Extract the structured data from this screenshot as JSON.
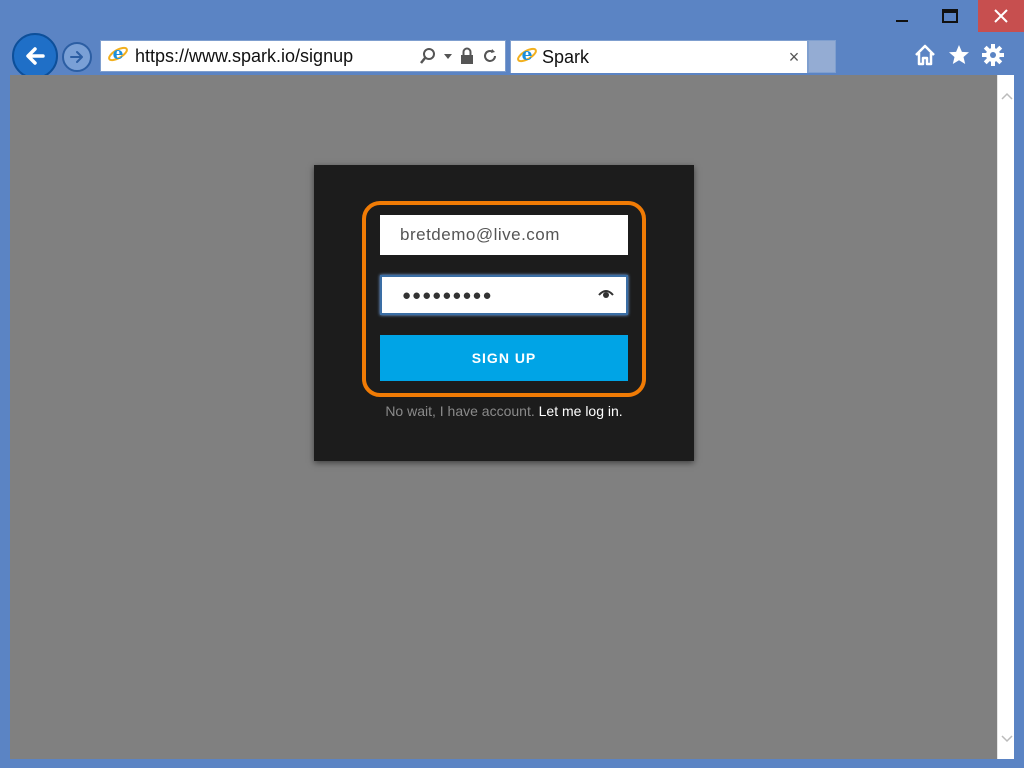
{
  "browser": {
    "url": "https://www.spark.io/signup",
    "tab_title": "Spark",
    "tab_close": "×",
    "icons": {
      "back": "back-arrow-icon",
      "forward": "forward-arrow-icon",
      "search": "search-icon",
      "lock": "lock-icon",
      "refresh": "refresh-icon",
      "home": "home-icon",
      "favorites": "star-icon",
      "settings": "gear-icon"
    }
  },
  "signup": {
    "email_value": "bretdemo@live.com",
    "password_value": "●●●●●●●●●",
    "submit_label": "SIGN UP",
    "login_prompt": "No wait, I have account.",
    "login_link": "Let me log in.",
    "highlight_color": "#f07b05",
    "button_color": "#00a4e6"
  }
}
